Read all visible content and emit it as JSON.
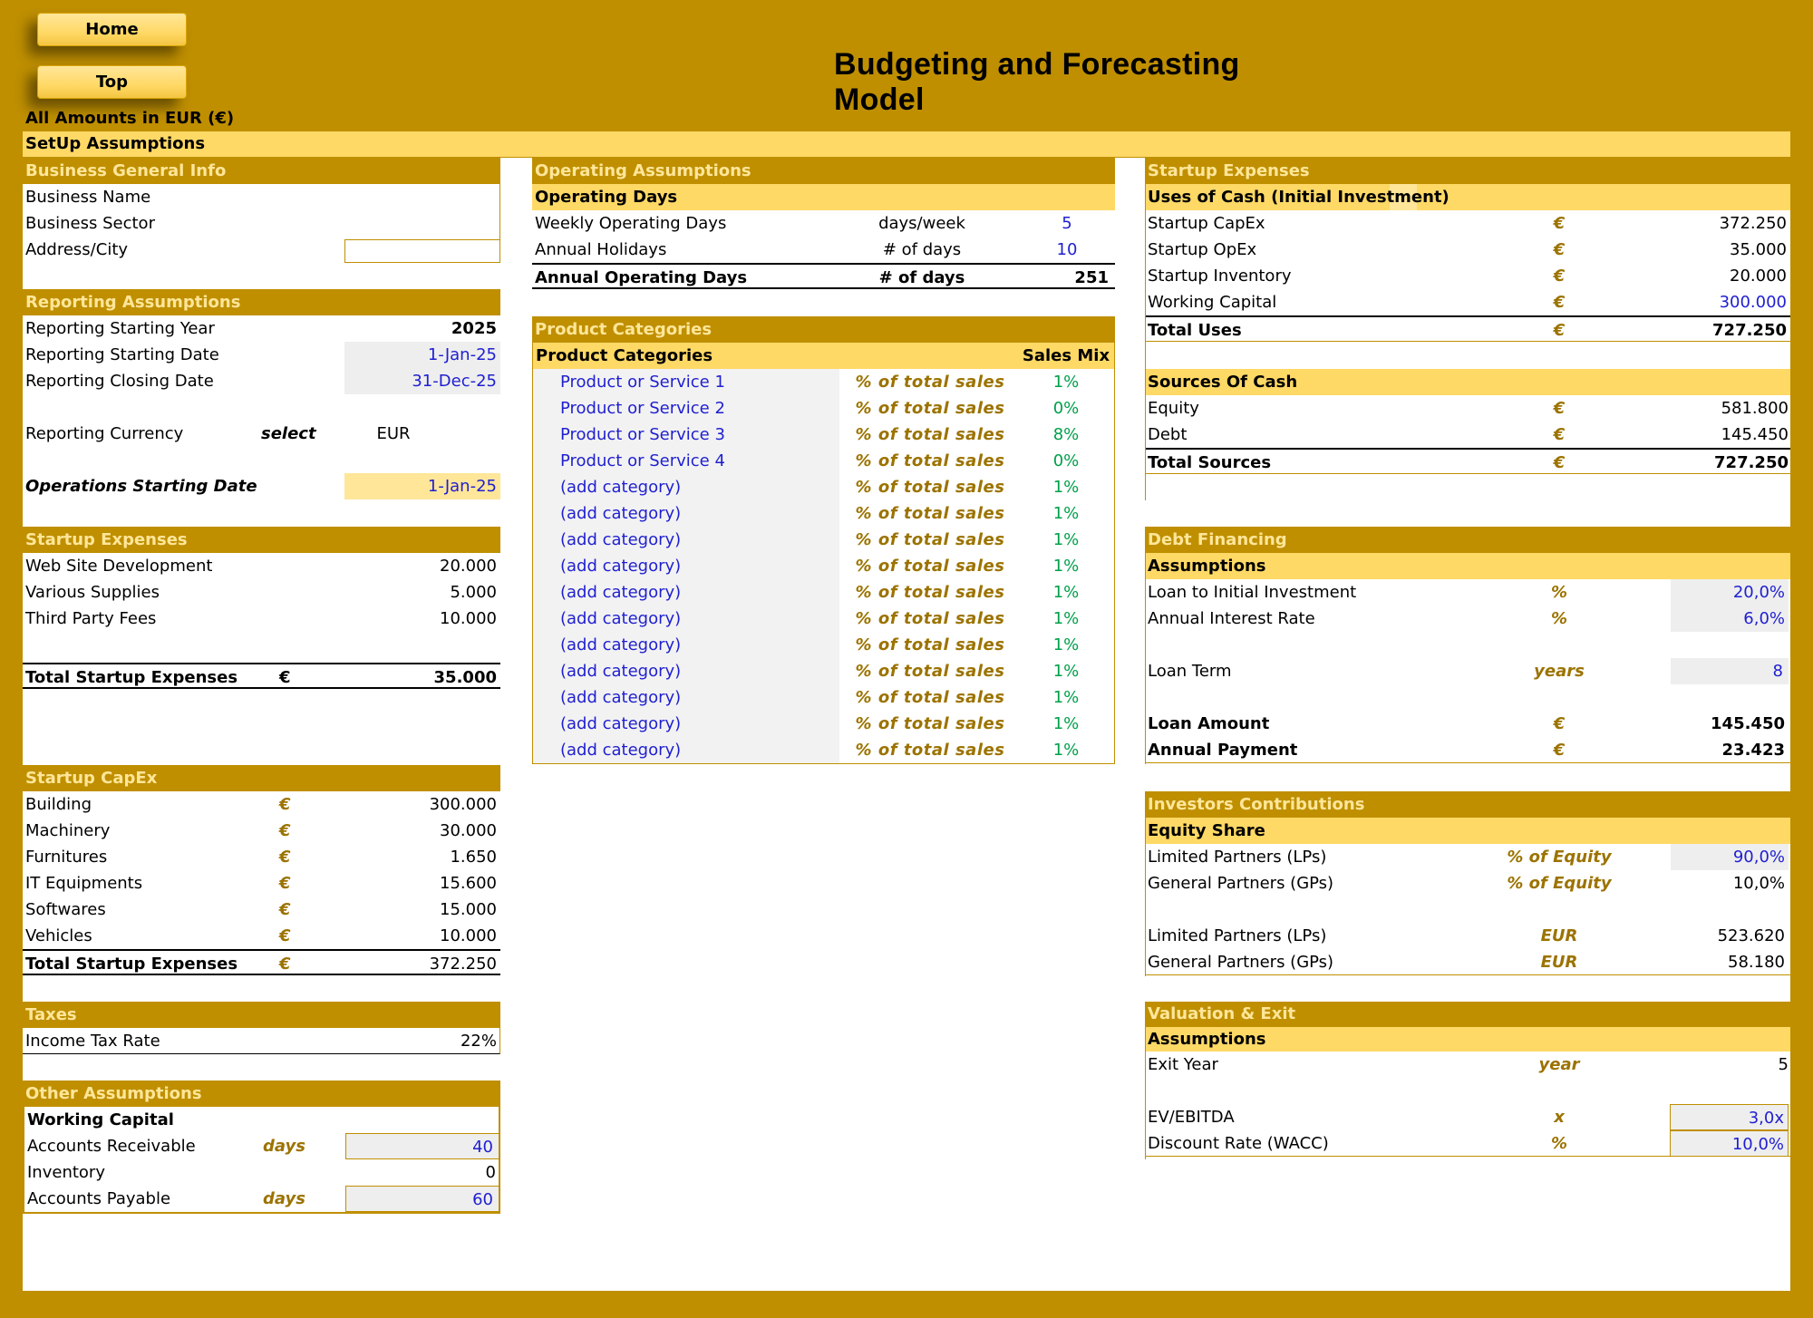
{
  "nav": {
    "home": "Home",
    "top": "Top"
  },
  "title": "Budgeting and Forecasting Model",
  "currency_note": "All Amounts in  EUR (€)",
  "setup_bar": "SetUp Assumptions",
  "colors": {
    "gold": "#bf8f00",
    "yellow": "#ffd966",
    "input_blue": "#1f1fd1",
    "mix_green": "#00a04a"
  },
  "general": {
    "header": "Business General Info",
    "rows": [
      "Business Name",
      "Business Sector",
      "Address/City"
    ]
  },
  "reporting": {
    "header": "Reporting Assumptions",
    "start_year_label": "Reporting Starting Year",
    "start_year": "2025",
    "start_date_label": "Reporting Starting Date",
    "start_date": "1-Jan-25",
    "close_date_label": "Reporting Closing Date",
    "close_date": "31-Dec-25",
    "currency_label": "Reporting Currency",
    "currency_select": "select",
    "currency": "EUR",
    "ops_start_label": "Operations Starting Date",
    "ops_start": "1-Jan-25"
  },
  "startup_exp": {
    "header": "Startup Expenses",
    "rows": [
      {
        "label": "Web Site Development",
        "value": "20.000"
      },
      {
        "label": "Various Supplies",
        "value": "5.000"
      },
      {
        "label": "Third Party Fees",
        "value": "10.000"
      }
    ],
    "total_label": "Total Startup Expenses",
    "total_unit": "€",
    "total": "35.000"
  },
  "capex": {
    "header": "Startup CapEx",
    "rows": [
      {
        "label": "Building",
        "unit": "€",
        "value": "300.000"
      },
      {
        "label": "Machinery",
        "unit": "€",
        "value": "30.000"
      },
      {
        "label": "Furnitures",
        "unit": "€",
        "value": "1.650"
      },
      {
        "label": "IT Equipments",
        "unit": "€",
        "value": "15.600"
      },
      {
        "label": "Softwares",
        "unit": "€",
        "value": "15.000"
      },
      {
        "label": "Vehicles",
        "unit": "€",
        "value": "10.000"
      }
    ],
    "total_label": "Total Startup Expenses",
    "total_unit": "€",
    "total": "372.250"
  },
  "taxes": {
    "header": "Taxes",
    "label": "Income Tax Rate",
    "value": "22%"
  },
  "other": {
    "header": "Other Assumptions",
    "sub": "Working Capital",
    "ar_label": "Accounts Receivable",
    "ar_unit": "days",
    "ar": "40",
    "inv_label": "Inventory",
    "inv": "0",
    "ap_label": "Accounts Payable",
    "ap_unit": "days",
    "ap": "60"
  },
  "operating": {
    "header": "Operating Assumptions",
    "sub": "Operating Days",
    "weekly_label": "Weekly Operating Days",
    "weekly_unit": "days/week",
    "weekly": "5",
    "holidays_label": "Annual Holidays",
    "holidays_unit": "# of days",
    "holidays": "10",
    "annual_label": "Annual Operating Days",
    "annual_unit": "# of days",
    "annual": "251"
  },
  "products": {
    "header": "Product Categories",
    "sub": "Product Categories",
    "mix_header": "Sales Mix",
    "unit": "% of total sales",
    "items": [
      {
        "name": "Product or Service 1",
        "mix": "1%"
      },
      {
        "name": "Product or Service 2",
        "mix": "0%"
      },
      {
        "name": "Product or Service 3",
        "mix": "8%"
      },
      {
        "name": "Product or Service 4",
        "mix": "0%"
      },
      {
        "name": "(add category)",
        "mix": "1%"
      },
      {
        "name": "(add category)",
        "mix": "1%"
      },
      {
        "name": "(add category)",
        "mix": "1%"
      },
      {
        "name": "(add category)",
        "mix": "1%"
      },
      {
        "name": "(add category)",
        "mix": "1%"
      },
      {
        "name": "(add category)",
        "mix": "1%"
      },
      {
        "name": "(add category)",
        "mix": "1%"
      },
      {
        "name": "(add category)",
        "mix": "1%"
      },
      {
        "name": "(add category)",
        "mix": "1%"
      },
      {
        "name": "(add category)",
        "mix": "1%"
      },
      {
        "name": "(add category)",
        "mix": "1%"
      }
    ]
  },
  "uses": {
    "header": "Startup Expenses",
    "sub": "Uses of Cash (Initial Investment)",
    "rows": [
      {
        "label": "Startup CapEx",
        "unit": "€",
        "value": "372.250"
      },
      {
        "label": "Startup OpEx",
        "unit": "€",
        "value": "35.000"
      },
      {
        "label": "Startup Inventory",
        "unit": "€",
        "value": "20.000"
      },
      {
        "label": "Working Capital",
        "unit": "€",
        "value": "300.000"
      }
    ],
    "total_label": "Total Uses",
    "total_unit": "€",
    "total": "727.250"
  },
  "sources": {
    "sub": "Sources Of Cash",
    "rows": [
      {
        "label": "Equity",
        "unit": "€",
        "value": "581.800"
      },
      {
        "label": "Debt",
        "unit": "€",
        "value": "145.450"
      }
    ],
    "total_label": "Total Sources",
    "total_unit": "€",
    "total": "727.250"
  },
  "debt": {
    "header": "Debt Financing",
    "sub": "Assumptions",
    "loan_pct_label": "Loan to Initial Investment",
    "loan_pct_unit": "%",
    "loan_pct": "20,0%",
    "rate_label": "Annual Interest Rate",
    "rate_unit": "%",
    "rate": "6,0%",
    "term_label": "Loan Term",
    "term_unit": "years",
    "term": "8",
    "amount_label": "Loan Amount",
    "amount_unit": "€",
    "amount": "145.450",
    "payment_label": "Annual Payment",
    "payment_unit": "€",
    "payment": "23.423"
  },
  "investors": {
    "header": "Investors Contributions",
    "sub": "Equity Share",
    "lp_label": "Limited Partners (LPs)",
    "lp_unit": "% of Equity",
    "lp_pct": "90,0%",
    "gp_label": "General Partners (GPs)",
    "gp_unit": "% of Equity",
    "gp_pct": "10,0%",
    "lp_amt_label": "Limited Partners (LPs)",
    "lp_amt_unit": "EUR",
    "lp_amt": "523.620",
    "gp_amt_label": "General Partners (GPs)",
    "gp_amt_unit": "EUR",
    "gp_amt": "58.180"
  },
  "valuation": {
    "header": "Valuation & Exit",
    "sub": "Assumptions",
    "exit_label": "Exit Year",
    "exit_unit": "year",
    "exit": "5",
    "ev_label": "EV/EBITDA",
    "ev_unit": "x",
    "ev": "3,0x",
    "wacc_label": "Discount Rate (WACC)",
    "wacc_unit": "%",
    "wacc": "10,0%"
  }
}
